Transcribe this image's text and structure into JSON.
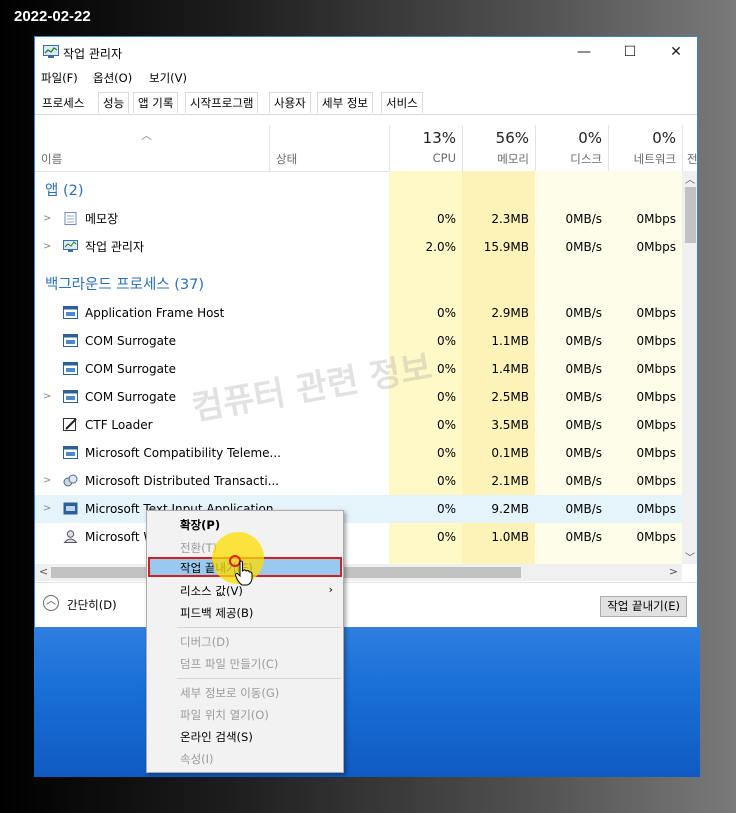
{
  "date_stamp": "2022-02-22",
  "window": {
    "title": "작업 관리자",
    "controls": {
      "minimize": "—",
      "maximize": "☐",
      "close": "✕"
    }
  },
  "menu": [
    "파일(F)",
    "옵션(O)",
    "보기(V)"
  ],
  "tabs": [
    "프로세스",
    "성능",
    "앱 기록",
    "시작프로그램",
    "사용자",
    "세부 정보",
    "서비스"
  ],
  "columns": {
    "name": "이름",
    "status": "상태",
    "cpu": {
      "pct": "13%",
      "label": "CPU"
    },
    "memory": {
      "pct": "56%",
      "label": "메모리"
    },
    "disk": {
      "pct": "0%",
      "label": "디스크"
    },
    "network": {
      "pct": "0%",
      "label": "네트워크"
    },
    "cut": "전"
  },
  "groups": {
    "apps": "앱 (2)",
    "background": "백그라운드 프로세스 (37)"
  },
  "app_rows": [
    {
      "name": "메모장",
      "cpu": "0%",
      "mem": "2.3MB",
      "disk": "0MB/s",
      "net": "0Mbps"
    },
    {
      "name": "작업 관리자",
      "cpu": "2.0%",
      "mem": "15.9MB",
      "disk": "0MB/s",
      "net": "0Mbps"
    }
  ],
  "bg_rows": [
    {
      "name": "Application Frame Host",
      "cpu": "0%",
      "mem": "2.9MB",
      "disk": "0MB/s",
      "net": "0Mbps"
    },
    {
      "name": "COM Surrogate",
      "cpu": "0%",
      "mem": "1.1MB",
      "disk": "0MB/s",
      "net": "0Mbps"
    },
    {
      "name": "COM Surrogate",
      "cpu": "0%",
      "mem": "1.4MB",
      "disk": "0MB/s",
      "net": "0Mbps"
    },
    {
      "name": "COM Surrogate",
      "cpu": "0%",
      "mem": "2.5MB",
      "disk": "0MB/s",
      "net": "0Mbps"
    },
    {
      "name": "CTF Loader",
      "cpu": "0%",
      "mem": "3.5MB",
      "disk": "0MB/s",
      "net": "0Mbps"
    },
    {
      "name": "Microsoft Compatibility Teleme...",
      "cpu": "0%",
      "mem": "0.1MB",
      "disk": "0MB/s",
      "net": "0Mbps"
    },
    {
      "name": "Microsoft Distributed Transacti...",
      "cpu": "0%",
      "mem": "2.1MB",
      "disk": "0MB/s",
      "net": "0Mbps"
    },
    {
      "name": "Microsoft Text Input Application",
      "cpu": "0%",
      "mem": "9.2MB",
      "disk": "0MB/s",
      "net": "0Mbps"
    },
    {
      "name": "Microsoft W",
      "cpu": "0%",
      "mem": "1.0MB",
      "disk": "0MB/s",
      "net": "0Mbps"
    }
  ],
  "footer": {
    "fewer_details": "간단히(D)",
    "end_task": "작업 끝내기(E)"
  },
  "context_menu": {
    "expand": "확장(P)",
    "switch": "전환(T)",
    "end_task": "작업 끝내기(E)",
    "resource_values": "리소스 값(V)",
    "feedback": "피드백 제공(B)",
    "debug": "디버그(D)",
    "dump": "덤프 파일 만들기(C)",
    "go_details": "세부 정보로 이동(G)",
    "open_location": "파일 위치 열기(O)",
    "search_online": "온라인 검색(S)",
    "properties": "속성(I)"
  },
  "watermark": "컴퓨터 관련 정보"
}
